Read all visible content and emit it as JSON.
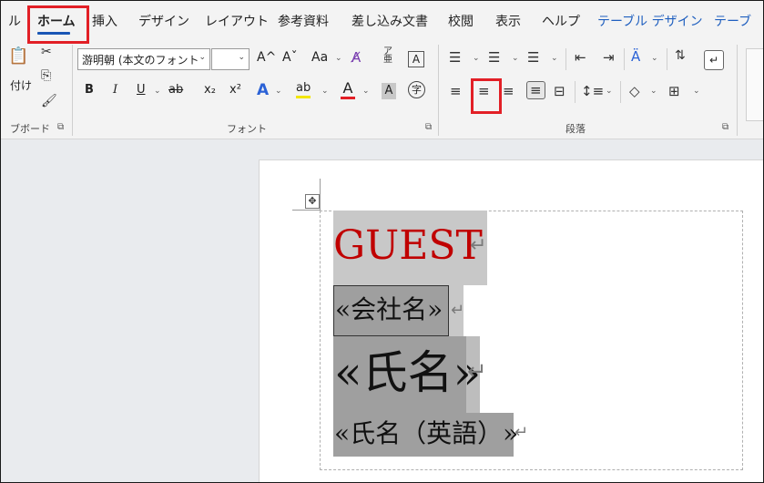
{
  "tabs": [
    {
      "id": "file",
      "label": "ル"
    },
    {
      "id": "home",
      "label": "ホーム"
    },
    {
      "id": "insert",
      "label": "挿入"
    },
    {
      "id": "design",
      "label": "デザイン"
    },
    {
      "id": "layout",
      "label": "レイアウト"
    },
    {
      "id": "references",
      "label": "参考資料"
    },
    {
      "id": "mailings",
      "label": "差し込み文書"
    },
    {
      "id": "review",
      "label": "校閲"
    },
    {
      "id": "view",
      "label": "表示"
    },
    {
      "id": "help",
      "label": "ヘルプ"
    },
    {
      "id": "table_design",
      "label": "テーブル デザイン"
    },
    {
      "id": "table_layout",
      "label": "テーブ"
    }
  ],
  "active_tab": "ホーム",
  "clipboard": {
    "paste_label": "付け",
    "group_label": "ブボード",
    "launcher": "⧉"
  },
  "font": {
    "font_name": "游明朝 (本文のフォント",
    "font_size": "",
    "grow_label": "A^",
    "shrink_label": "Aˇ",
    "case_label": "Aa",
    "bold": "B",
    "italic": "I",
    "underline": "U",
    "strike": "ab",
    "subscript": "x₂",
    "superscript": "x²",
    "effects": "A",
    "highlight": "ab",
    "font_color": "A",
    "char_shading": "A",
    "enclose": "字",
    "phonetic": "亜",
    "border_char": "A",
    "group_label": "フォント",
    "launcher": "⧉"
  },
  "paragraph": {
    "group_label": "段落",
    "launcher": "⧉"
  },
  "document": {
    "guest": "GUEST",
    "company": "«会社名»",
    "name": "«氏名»",
    "name_en": "«氏名（英語）»",
    "para_mark": "↵"
  },
  "colors": {
    "accent": "#1a56b5",
    "highlight_box": "#e21f26",
    "guest_text": "#c00000",
    "table_design_tab": "#1f5fbf"
  }
}
